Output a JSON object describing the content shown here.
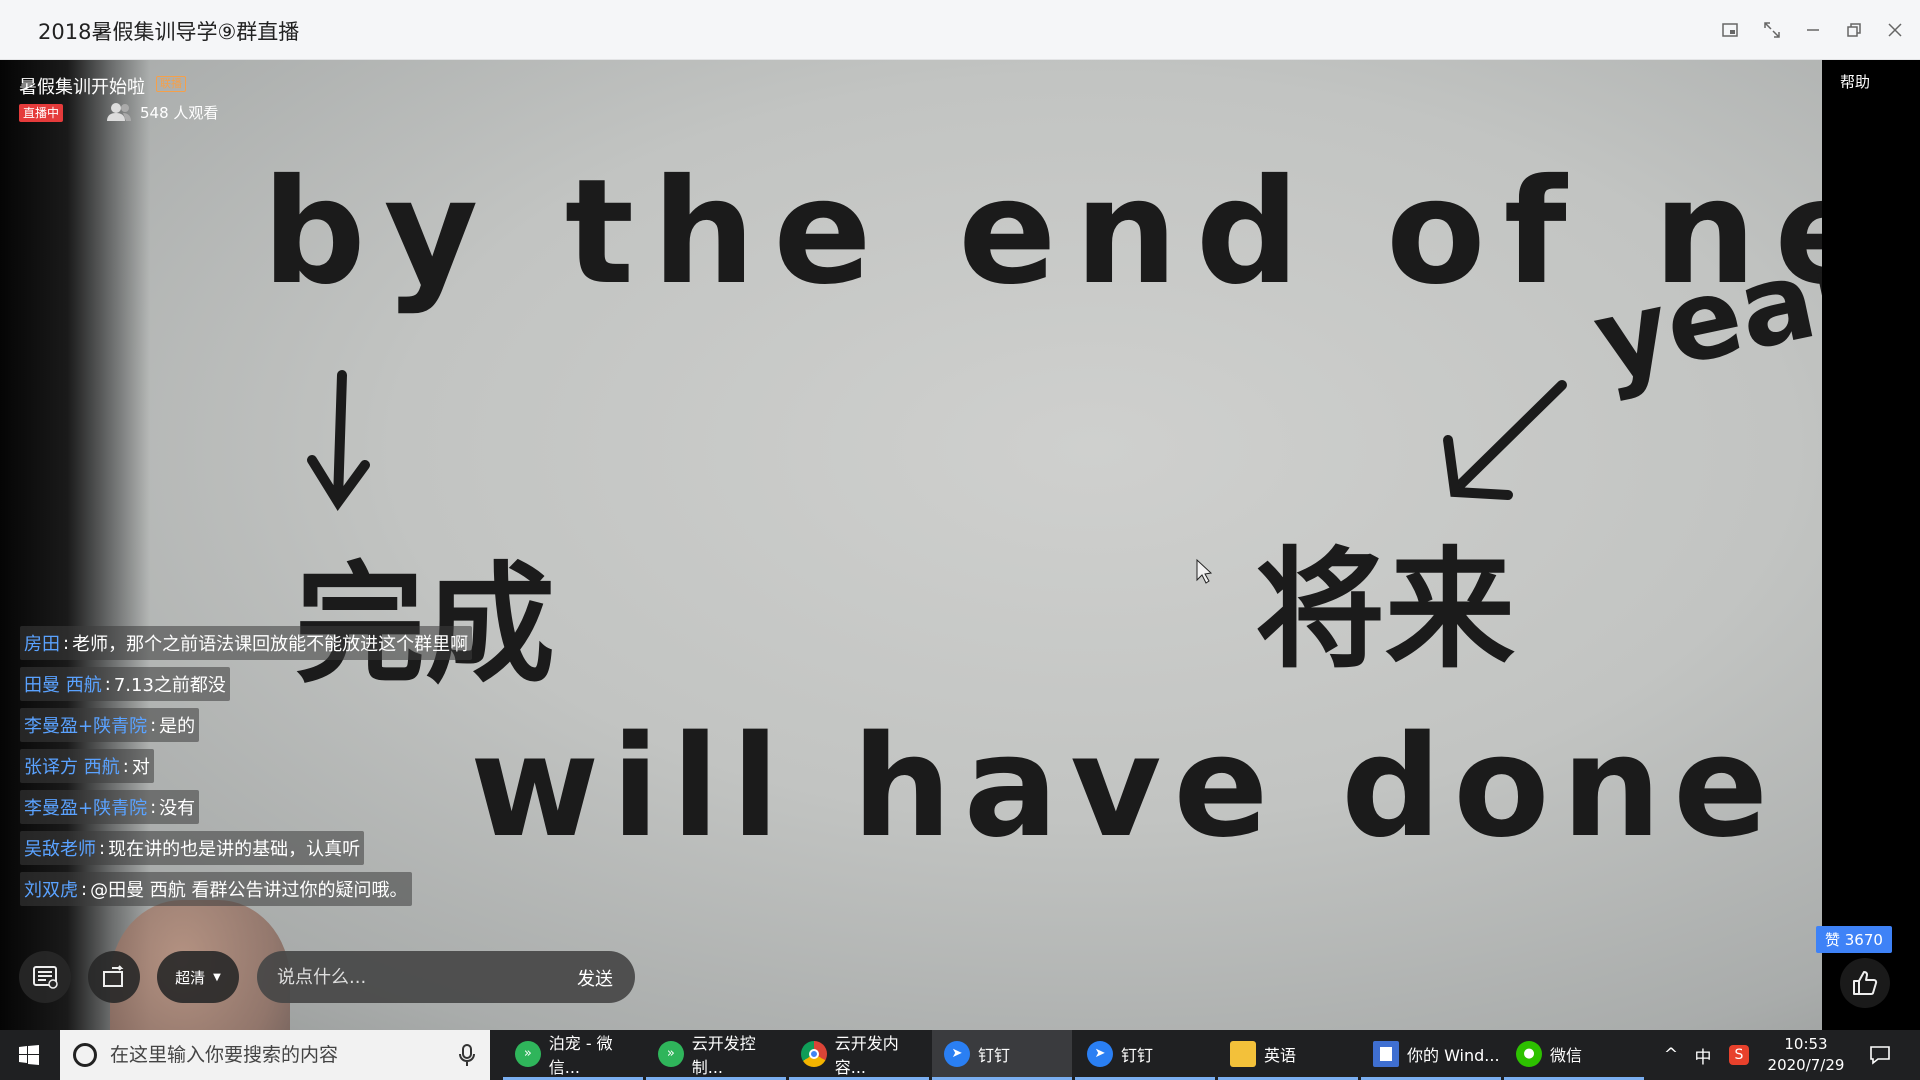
{
  "window": {
    "title": "2018暑假集训导学⑨群直播"
  },
  "live": {
    "room_title": "暑假集训开始啦",
    "room_tag": "联播",
    "status_badge": "直播中",
    "viewers": "548 人观看",
    "help": "帮助",
    "likes": "赞 3670"
  },
  "board": {
    "line1": "by the end of next",
    "word_year": "year",
    "word_complete": "完成",
    "word_future": "将来",
    "line3": "will have done"
  },
  "chat": [
    {
      "user": "房田",
      "text": "老师，那个之前语法课回放能不能放进这个群里啊"
    },
    {
      "user": "田曼 西航",
      "text": "7.13之前都没"
    },
    {
      "user": "李曼盈+陕青院",
      "text": "是的"
    },
    {
      "user": "张译方 西航",
      "text": "对"
    },
    {
      "user": "李曼盈+陕青院",
      "text": "没有"
    },
    {
      "user": "吴敌老师",
      "text": "现在讲的也是讲的基础，认真听"
    },
    {
      "user": "刘双虎",
      "text": "@田曼 西航 看群公告讲过你的疑问哦。"
    }
  ],
  "chat_sep": ":",
  "controls": {
    "quality": "超清",
    "comment_placeholder": "说点什么...",
    "send": "发送"
  },
  "taskbar": {
    "search_placeholder": "在这里输入你要搜索的内容",
    "tasks": [
      {
        "label": "泊宠 - 微信...",
        "icon": "wechat-devtools-icon"
      },
      {
        "label": "云开发控制...",
        "icon": "wechat-devtools-icon"
      },
      {
        "label": "云开发内容...",
        "icon": "chrome-icon"
      },
      {
        "label": "钉钉",
        "icon": "dingtalk-icon"
      },
      {
        "label": "钉钉",
        "icon": "dingtalk-icon"
      },
      {
        "label": "英语",
        "icon": "folder-icon"
      },
      {
        "label": "你的 Wind...",
        "icon": "document-icon"
      },
      {
        "label": "微信",
        "icon": "wechat-icon"
      }
    ],
    "ime": "中",
    "time": "10:53",
    "date": "2020/7/29"
  },
  "colors": {
    "chat_user": "#5aa2ff",
    "live_badge": "#e53b3b",
    "likes_badge": "#3e82f7",
    "taskbar": "#1f2022"
  }
}
